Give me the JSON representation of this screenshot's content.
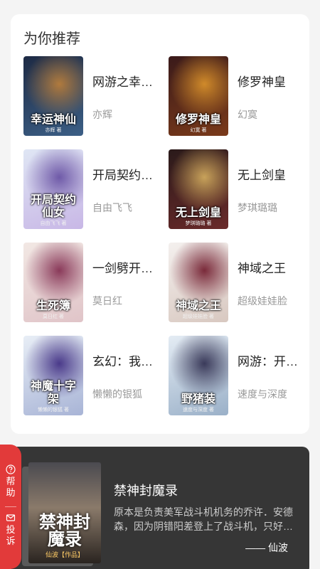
{
  "recommend": {
    "title": "为你推荐",
    "books": [
      {
        "title": "网游之幸运神仙",
        "author": "亦辉",
        "cover_title": "幸运神仙",
        "cover_author": "亦辉 著",
        "cover_colors": [
          "#1d2a44",
          "#3c5f86",
          "#b07a3d"
        ]
      },
      {
        "title": "修罗神皇",
        "author": "幻寞",
        "cover_title": "修罗神皇",
        "cover_author": "幻寞 著",
        "cover_colors": [
          "#3a1a1a",
          "#7a3a1a",
          "#d08a2a"
        ]
      },
      {
        "title": "开局契约仙女",
        "author": "自由飞飞",
        "cover_title": "开局契约仙女",
        "cover_author": "自由飞飞 著",
        "cover_colors": [
          "#dfe6f4",
          "#c8b7e6",
          "#6f5aa8"
        ]
      },
      {
        "title": "无上剑皇",
        "author": "梦琪璐璐",
        "cover_title": "无上剑皇",
        "cover_author": "梦琪璐璐 著",
        "cover_colors": [
          "#2a1a1a",
          "#6a2a2a",
          "#c8a25a"
        ]
      },
      {
        "title": "一剑劈开天门",
        "author": "莫日红",
        "cover_title": "生死簿",
        "cover_author": "莫日红 著",
        "cover_colors": [
          "#f2e8e4",
          "#e0c4c8",
          "#8a3a5a"
        ]
      },
      {
        "title": "神域之王",
        "author": "超级娃娃脸",
        "cover_title": "神域之王",
        "cover_author": "超级娃娃脸 著",
        "cover_colors": [
          "#f4f0ee",
          "#d8c8c0",
          "#7a2a3a"
        ]
      },
      {
        "title": "玄幻：我有神魔十字架",
        "author": "懒懒的银狐",
        "cover_title": "神魔十字架",
        "cover_author": "懒懒的银狐 著",
        "cover_colors": [
          "#e8eef6",
          "#a8b4d6",
          "#4a3a8a"
        ]
      },
      {
        "title": "网游：开局野猪装",
        "author": "速度与深度",
        "cover_title": "野猪装",
        "cover_author": "速度与深度 著",
        "cover_colors": [
          "#e4ecf4",
          "#9ab0c8",
          "#3a3a5a"
        ]
      }
    ]
  },
  "featured": {
    "title": "禁神封魔录",
    "description": "原本是负责美军战斗机机务的乔许．安德森，因为阴错阳差登上了战斗机，只好驾驶战斗机去执行任务",
    "author": "—— 仙波",
    "cover_title": "禁神封魔录",
    "cover_author": "仙波【作品】",
    "cover_colors": [
      "#4a4a50",
      "#8a7a6a",
      "#2a2420"
    ]
  },
  "help_tab": {
    "help_label": "帮助",
    "complaint_label": "投诉"
  },
  "colors": {
    "accent": "#e23a3a",
    "panel": "#363636",
    "background": "#f4f4f4"
  }
}
